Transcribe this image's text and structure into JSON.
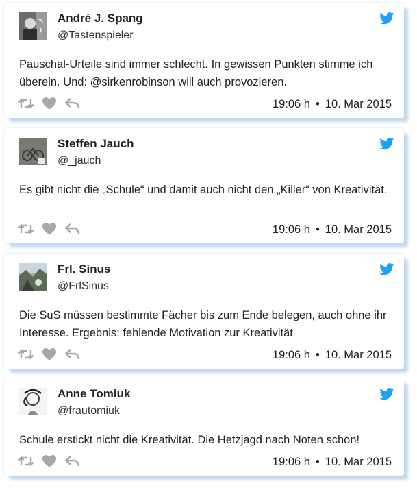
{
  "tweets": [
    {
      "name": "André J. Spang",
      "handle": "@Tastenspieler",
      "text": "Pauschal-Urteile sind immer schlecht. In gewissen Punkten stimme ich überein. Und: @sirkenrobinson will auch provozieren.",
      "time": "19:06 h",
      "separator": "•",
      "date": "10. Mar 2015"
    },
    {
      "name": "Steffen Jauch",
      "handle": "@_jauch",
      "text": "Es gibt nicht die „Schule“ und damit auch nicht den „Killer“ von Kreativität.",
      "time": "19:06 h",
      "separator": "•",
      "date": "10. Mar 2015"
    },
    {
      "name": "Frl. Sinus",
      "handle": "@FrlSinus",
      "text": "Die SuS müssen bestimmte Fächer bis zum Ende belegen, auch ohne ihr Interesse. Ergebnis: fehlende Motivation zur Kreativität",
      "time": "19:06 h",
      "separator": "•",
      "date": "10. Mar 2015"
    },
    {
      "name": "Anne Tomiuk",
      "handle": "@frautomiuk",
      "text": "Schule erstickt nicht die Kreativität. Die Hetzjagd nach Noten schon!",
      "time": "19:06 h",
      "separator": "•",
      "date": "10. Mar 2015"
    }
  ],
  "colors": {
    "twitter_blue": "#1da1f2",
    "action_gray": "#a8a8a8",
    "card_shadow": "#c2d9ef"
  },
  "icons": [
    "twitter-bird-icon",
    "retweet-icon",
    "heart-icon",
    "reply-icon"
  ]
}
